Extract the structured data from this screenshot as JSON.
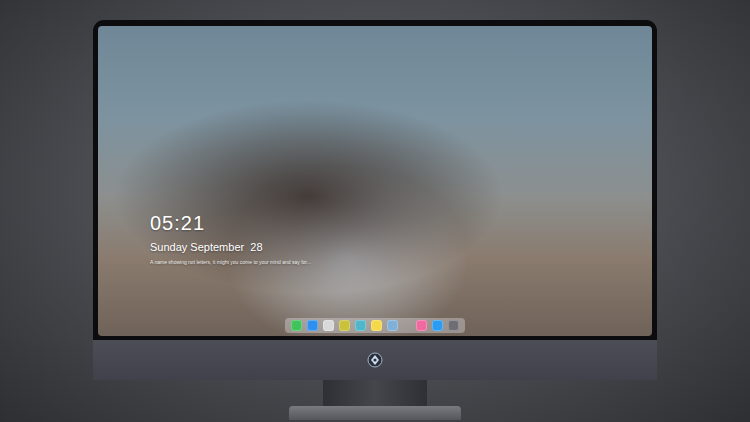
{
  "lock_screen": {
    "time": "05:21",
    "date": "Sunday September  28",
    "message": "A name showing not letters, it might you come to your mind and say for..."
  },
  "dock": {
    "groups": [
      [
        {
          "color": "#3fc35a"
        },
        {
          "color": "#2f8ff0"
        },
        {
          "color": "#d9d9d9"
        },
        {
          "color": "#c9c23a"
        },
        {
          "color": "#4fb7c9"
        },
        {
          "color": "#f5d94a"
        },
        {
          "color": "#7fb0d8"
        }
      ],
      [
        {
          "color": "#f06aa0"
        },
        {
          "color": "#2b9cf2"
        },
        {
          "color": "#6e6e74"
        }
      ]
    ]
  }
}
